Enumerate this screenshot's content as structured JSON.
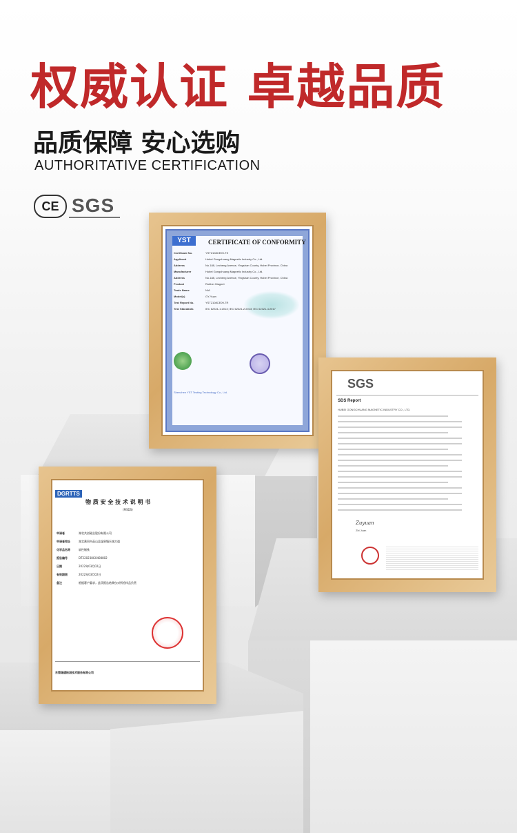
{
  "header": {
    "title": "权威认证 卓越品质",
    "subtitle": "品质保障 安心选购",
    "subtitle_en": "AUTHORITATIVE CERTIFICATION",
    "badges": {
      "ce": "CE",
      "sgs": "SGS"
    }
  },
  "colors": {
    "title": "#c0292a",
    "frame": "#d7a968"
  },
  "cert_yst": {
    "logo": "YST",
    "title": "CERTIFICATE OF CONFORMITY",
    "rows": [
      {
        "k": "Certificate No.",
        "v": "YST2108CE09-TS"
      },
      {
        "k": "Applicant",
        "v": "Hubei Gongchuang Magnetic Industry Co., Ltd."
      },
      {
        "k": "Address",
        "v": "No.188, Lecheng Avenue, Yingshan County, Hubei Province, China"
      },
      {
        "k": "Manufacturer",
        "v": "Hubei Gongchuang Magnetic Industry Co., Ltd."
      },
      {
        "k": "Address",
        "v": "No.188, Lecheng Avenue, Yingshan County, Hubei Province, China"
      },
      {
        "k": "Product",
        "v": "Rubber Magnet"
      },
      {
        "k": "Trade Name",
        "v": "N/A"
      },
      {
        "k": "Model(s)",
        "v": "GY-Yuan"
      },
      {
        "k": "Test Report No.",
        "v": "YST2108CE09-TR"
      },
      {
        "k": "Test Standards",
        "v": "IEC 62321-1:2013; IEC 62321-2:2013; IEC 62321-4:2017"
      }
    ],
    "footer": "Shenzhen YST Testing Technology Co., Ltd."
  },
  "report_sgs": {
    "logo": "SGS",
    "title": "SDS Report",
    "company": "HUBEI GONGCHUANG MAGNETIC INDUSTRY CO., LTD.",
    "signer": "Zhi Juan"
  },
  "doc_dgrtts": {
    "logo": "DGRTTS",
    "title": "物 质 安 全 技 术 说 明 书",
    "code": "(MSDS)",
    "rows": [
      {
        "k": "申请者",
        "v": "湖北共创磁业股份有限公司"
      },
      {
        "k": "申请者地址",
        "v": "湖北黄冈市英山县温泉镇乐城大道"
      },
      {
        "k": "化学品名称",
        "v": "软性磁铁"
      },
      {
        "k": "报告编号",
        "v": "DT220238G0408802"
      },
      {
        "k": "日期",
        "v": "2022年03月02日"
      },
      {
        "k": "有效期限",
        "v": "2022年03月02日"
      },
      {
        "k": "备注",
        "v": "根据客户要求，此项报告结果仅对所检样品负责"
      }
    ],
    "footer": "东莞瑞通检测技术服务有限公司"
  }
}
